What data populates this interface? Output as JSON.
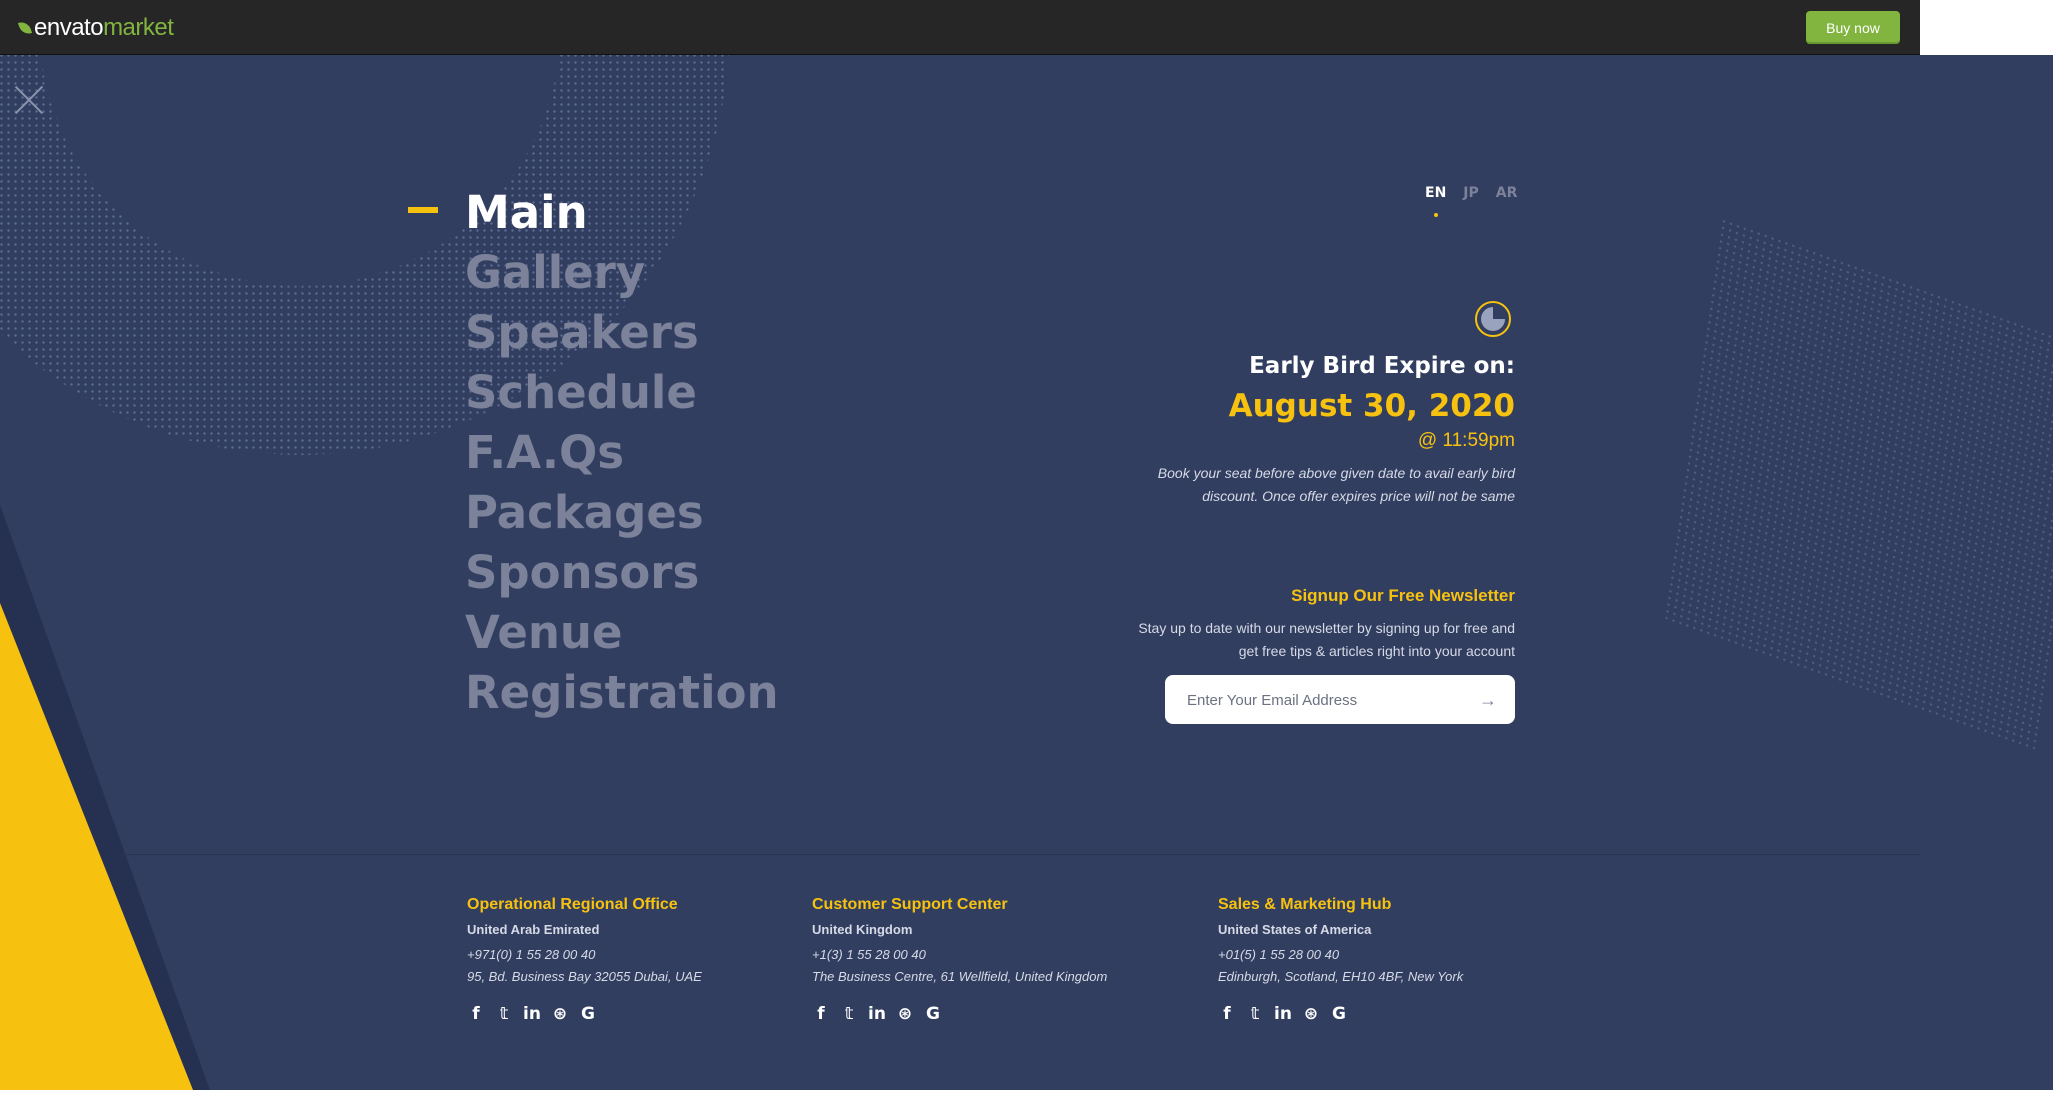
{
  "topbar": {
    "logo_word": "envato",
    "logo_accent": "market",
    "buy_label": "Buy now"
  },
  "menu": {
    "items": [
      "Main",
      "Gallery",
      "Speakers",
      "Schedule",
      "F.A.Qs",
      "Packages",
      "Sponsors",
      "Venue",
      "Registration"
    ],
    "active": "Main"
  },
  "languages": [
    "EN",
    "JP",
    "AR"
  ],
  "early_bird": {
    "title": "Early Bird Expire on:",
    "date": "August 30, 2020",
    "time": "@ 11:59pm",
    "description": "Book your seat before above given date to avail early bird discount. Once offer expires price will not be same"
  },
  "newsletter": {
    "title": "Signup Our Free Newsletter",
    "description": "Stay up to date with our newsletter by signing up for free and get free tips & articles right into your account",
    "placeholder": "Enter Your Email Address"
  },
  "offices": [
    {
      "title": "Operational Regional Office",
      "country": "United Arab Emirated",
      "phone": "+971(0) 1 55 28 00 40",
      "address": "95, Bd. Business Bay 32055 Dubai, UAE"
    },
    {
      "title": "Customer Support Center",
      "country": "United Kingdom",
      "phone": "+1(3) 1 55 28 00 40",
      "address": "The Business Centre, 61 Wellfield, United Kingdom"
    },
    {
      "title": "Sales & Marketing Hub",
      "country": "United States of America",
      "phone": "+01(5) 1 55 28 00 40",
      "address": "Edinburgh, Scotland, EH10 4BF, New York"
    }
  ],
  "social_icons": [
    "facebook-icon",
    "twitter-icon",
    "linkedin-icon",
    "dribbble-icon",
    "google-icon"
  ],
  "colors": {
    "panel_bg": "#323e60",
    "accent_yellow": "#f7c20f",
    "buy_green": "#82b440",
    "topbar": "#262626",
    "muted_menu": "#7b829a"
  }
}
